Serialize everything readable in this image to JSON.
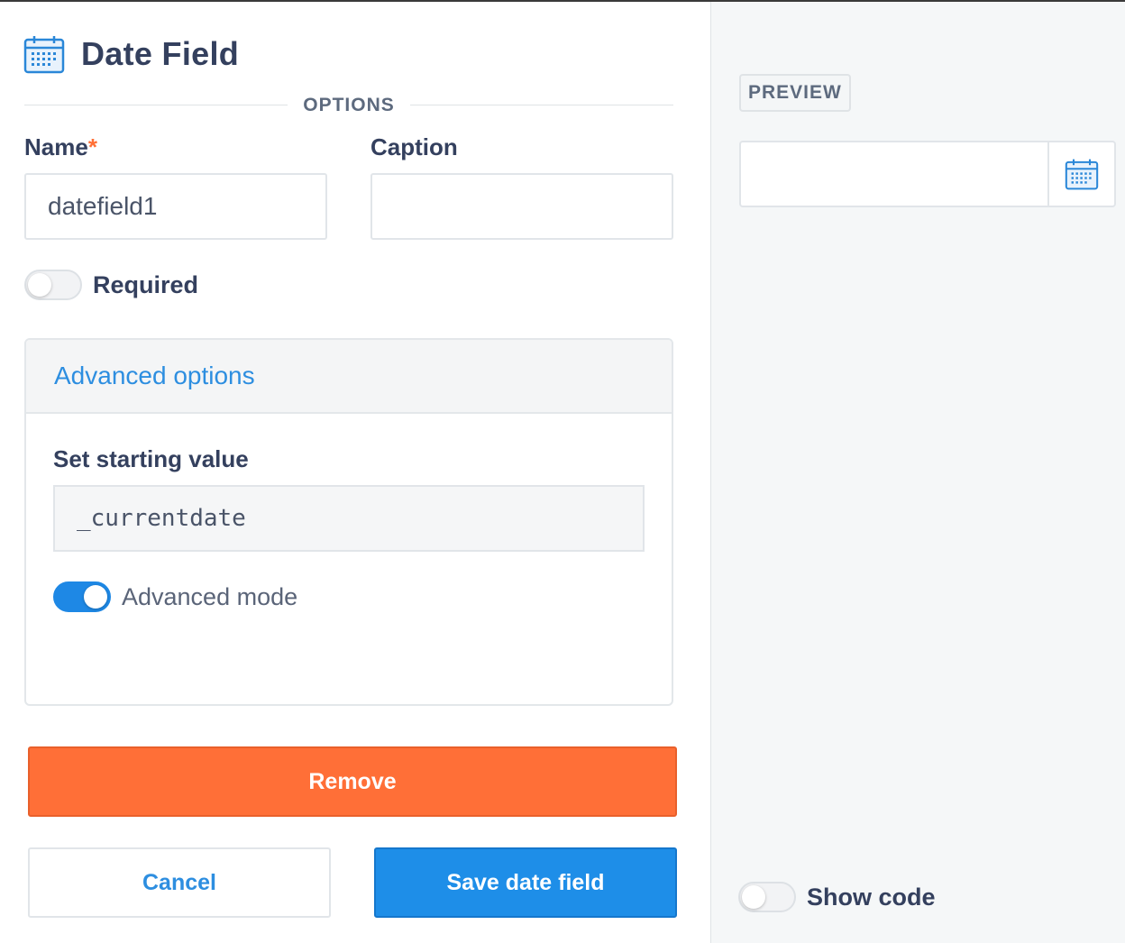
{
  "header": {
    "title": "Date Field",
    "icon": "calendar-icon"
  },
  "options_divider": {
    "label": "OPTIONS"
  },
  "name_field": {
    "label": "Name",
    "required_marker": "*",
    "value": "datefield1"
  },
  "caption_field": {
    "label": "Caption",
    "value": ""
  },
  "required_toggle": {
    "label": "Required",
    "checked": false
  },
  "advanced": {
    "title": "Advanced options",
    "starting_value_label": "Set starting value",
    "starting_value": "_currentdate",
    "mode_toggle": {
      "label": "Advanced mode",
      "checked": true
    }
  },
  "buttons": {
    "remove": "Remove",
    "cancel": "Cancel",
    "save": "Save date field"
  },
  "preview": {
    "badge": "PREVIEW",
    "input_value": "",
    "addon_icon": "calendar-icon"
  },
  "show_code_toggle": {
    "label": "Show code",
    "checked": false
  },
  "colors": {
    "accent": "#1e88e5",
    "danger": "#ff6f37",
    "required": "#ff6f35",
    "link": "#2d8ee0"
  }
}
